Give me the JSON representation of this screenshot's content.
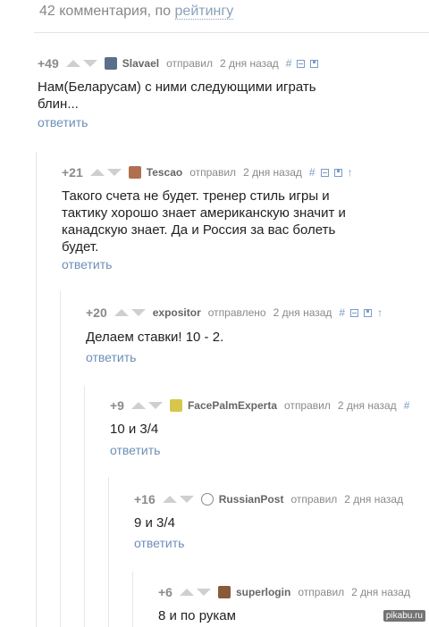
{
  "header": {
    "count_text": "42 комментария, по",
    "sort_label": "рейтингу"
  },
  "actions": {
    "reply": "ответить",
    "hash": "#",
    "up": "↑"
  },
  "comments": [
    {
      "rating": "+49",
      "author": "Slavael",
      "sent": "отправил",
      "time": "2 дня назад",
      "text": [
        "Нам(Беларусам) с ними следующими играть",
        "блин..."
      ]
    },
    {
      "rating": "+21",
      "author": "Tescao",
      "sent": "отправил",
      "time": "2 дня назад",
      "text": [
        "Такого счета не будет. тренер стиль игры и",
        "тактику хорошо знает американскую значит и",
        "канадскую знает. Да и Россия за вас болеть",
        "будет."
      ]
    },
    {
      "rating": "+20",
      "author": "expositor",
      "sent": "отправлено",
      "time": "2 дня назад",
      "text": [
        "Делаем ставки! 10 - 2."
      ]
    },
    {
      "rating": "+9",
      "author": "FacePalmExperta",
      "sent": "отправил",
      "time": "2 дня назад",
      "text": [
        "10 и 3/4"
      ]
    },
    {
      "rating": "+16",
      "author": "RussianPost",
      "sent": "отправил",
      "time": "2 дня назад",
      "text": [
        "9 и 3/4"
      ]
    },
    {
      "rating": "+6",
      "author": "superlogin",
      "sent": "отправил",
      "time": "2 дня назад",
      "text": [
        "8 и по рукам"
      ]
    }
  ],
  "watermark": "pikabu.ru",
  "colors": {
    "link": "#6d8fb8",
    "icon": "#7a9cc8",
    "muted": "#8a8a8a"
  }
}
